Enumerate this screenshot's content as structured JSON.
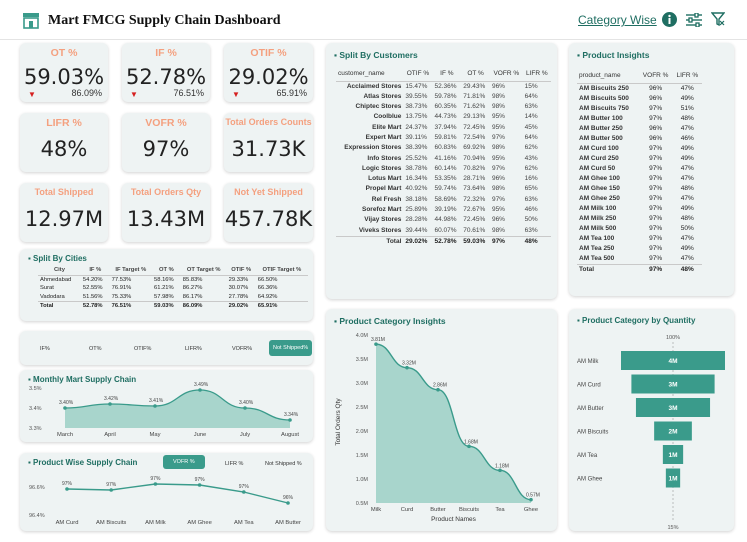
{
  "header": {
    "title": "Mart FMCG Supply Chain Dashboard",
    "link": "Category Wise",
    "icons": [
      "store-icon",
      "info-icon",
      "sliders-icon",
      "filter-clear-icon"
    ]
  },
  "colors": {
    "teal": "#3a9b8b",
    "orange": "#f4a07f",
    "card": "#eef3f3"
  },
  "kpis": {
    "ot": {
      "label": "OT %",
      "value": "59.03%",
      "target": "86.09%"
    },
    "if": {
      "label": "IF %",
      "value": "52.78%",
      "target": "76.51%"
    },
    "otif": {
      "label": "OTIF %",
      "value": "29.02%",
      "target": "65.91%"
    },
    "lifr": {
      "label": "LIFR %",
      "value": "48%"
    },
    "vofr": {
      "label": "VOFR %",
      "value": "97%"
    },
    "orders": {
      "label": "Total Orders Counts",
      "value": "31.73K"
    },
    "shipped": {
      "label": "Total Shipped",
      "value": "12.97M"
    },
    "qty": {
      "label": "Total Orders Qty",
      "value": "13.43M"
    },
    "notship": {
      "label": "Not Yet Shipped",
      "value": "457.78K"
    }
  },
  "cities": {
    "title": "Split By Cities",
    "headers": [
      "City",
      "IF %",
      "IF Target %",
      "OT %",
      "OT Target %",
      "OTIF %",
      "OTIF Target %"
    ],
    "rows": [
      [
        "Ahmedabad",
        "54.20%",
        "77.53%",
        "58.16%",
        "85.83%",
        "29.33%",
        "66.50%"
      ],
      [
        "Surat",
        "52.55%",
        "76.91%",
        "61.21%",
        "86.27%",
        "30.07%",
        "66.36%"
      ],
      [
        "Vadodara",
        "51.56%",
        "75.33%",
        "57.98%",
        "86.17%",
        "27.78%",
        "64.92%"
      ]
    ],
    "total": [
      "Total",
      "52.78%",
      "76.51%",
      "59.03%",
      "86.09%",
      "29.02%",
      "65.91%"
    ]
  },
  "toggles": {
    "items": [
      "IF%",
      "OT%",
      "OTIF%",
      "LIFR%",
      "VOFR%"
    ],
    "active": "Not Shipped%"
  },
  "customers": {
    "title": "Split By Customers",
    "headers": [
      "customer_name",
      "OTIF %",
      "IF %",
      "OT %",
      "VOFR %",
      "LIFR %"
    ],
    "rows": [
      [
        "Acclaimed Stores",
        "15.47%",
        "52.36%",
        "29.43%",
        "96%",
        "15%"
      ],
      [
        "Atlas Stores",
        "39.55%",
        "59.78%",
        "71.81%",
        "98%",
        "64%"
      ],
      [
        "Chiptec Stores",
        "38.73%",
        "60.35%",
        "71.62%",
        "98%",
        "63%"
      ],
      [
        "Coolblue",
        "13.75%",
        "44.73%",
        "29.13%",
        "95%",
        "14%"
      ],
      [
        "Elite Mart",
        "24.37%",
        "37.94%",
        "72.45%",
        "95%",
        "45%"
      ],
      [
        "Expert Mart",
        "39.11%",
        "59.81%",
        "72.54%",
        "97%",
        "64%"
      ],
      [
        "Expression Stores",
        "38.39%",
        "60.83%",
        "69.92%",
        "98%",
        "62%"
      ],
      [
        "Info Stores",
        "25.52%",
        "41.16%",
        "70.94%",
        "95%",
        "43%"
      ],
      [
        "Logic Stores",
        "38.78%",
        "60.14%",
        "70.82%",
        "97%",
        "62%"
      ],
      [
        "Lotus Mart",
        "16.34%",
        "53.35%",
        "28.71%",
        "96%",
        "16%"
      ],
      [
        "Propel Mart",
        "40.92%",
        "59.74%",
        "73.64%",
        "98%",
        "65%"
      ],
      [
        "Rel Fresh",
        "38.18%",
        "58.69%",
        "72.32%",
        "97%",
        "63%"
      ],
      [
        "Sorefoz Mart",
        "25.89%",
        "39.19%",
        "72.67%",
        "95%",
        "46%"
      ],
      [
        "Vijay Stores",
        "28.28%",
        "44.98%",
        "72.45%",
        "96%",
        "50%"
      ],
      [
        "Viveks Stores",
        "39.44%",
        "60.07%",
        "70.61%",
        "98%",
        "63%"
      ]
    ],
    "total": [
      "Total",
      "29.02%",
      "52.78%",
      "59.03%",
      "97%",
      "48%"
    ]
  },
  "products": {
    "title": "Product Insights",
    "headers": [
      "product_name",
      "VOFR %",
      "LIFR %"
    ],
    "rows": [
      [
        "AM Biscuits 250",
        "96%",
        "47%"
      ],
      [
        "AM Biscuits 500",
        "96%",
        "49%"
      ],
      [
        "AM Biscuits 750",
        "97%",
        "51%"
      ],
      [
        "AM Butter 100",
        "97%",
        "48%"
      ],
      [
        "AM Butter 250",
        "96%",
        "47%"
      ],
      [
        "AM Butter 500",
        "96%",
        "46%"
      ],
      [
        "AM Curd 100",
        "97%",
        "49%"
      ],
      [
        "AM Curd 250",
        "97%",
        "49%"
      ],
      [
        "AM Curd 50",
        "97%",
        "47%"
      ],
      [
        "AM Ghee 100",
        "97%",
        "47%"
      ],
      [
        "AM Ghee 150",
        "97%",
        "48%"
      ],
      [
        "AM Ghee 250",
        "97%",
        "47%"
      ],
      [
        "AM Milk 100",
        "97%",
        "49%"
      ],
      [
        "AM Milk 250",
        "97%",
        "48%"
      ],
      [
        "AM Milk 500",
        "97%",
        "50%"
      ],
      [
        "AM Tea 100",
        "97%",
        "47%"
      ],
      [
        "AM Tea 250",
        "97%",
        "49%"
      ],
      [
        "AM Tea 500",
        "97%",
        "47%"
      ]
    ],
    "total": [
      "Total",
      "97%",
      "48%"
    ]
  },
  "chart_data": [
    {
      "type": "area",
      "title": "Monthly Mart Supply Chain",
      "x": [
        "March",
        "April",
        "May",
        "June",
        "July",
        "August"
      ],
      "values": [
        3.4,
        3.42,
        3.41,
        3.49,
        3.4,
        3.34
      ],
      "ytick_labels": [
        "3.5%",
        "3.4%",
        "3.3%"
      ],
      "data_labels": [
        "3.40%",
        "3.42%",
        "3.41%",
        "3.49%",
        "3.40%",
        "3.34%"
      ],
      "ylim": [
        3.3,
        3.5
      ]
    },
    {
      "type": "line",
      "title": "Product Wise Supply Chain",
      "toggles": {
        "active": "VOFR %",
        "items": [
          "LIFR %",
          "Not Shipped %"
        ]
      },
      "x": [
        "AM Curd",
        "AM Biscuits",
        "AM Milk",
        "AM Ghee",
        "AM Tea",
        "AM Butter"
      ],
      "values": [
        97,
        97,
        97,
        97,
        97,
        96
      ],
      "data_labels": [
        "97%",
        "97%",
        "97%",
        "97%",
        "97%",
        "96%"
      ],
      "ytick_labels": [
        "96.6%",
        "96.4%"
      ]
    },
    {
      "type": "area",
      "title": "Product Category Insights",
      "x": [
        "Milk",
        "Curd",
        "Butter",
        "Biscuits",
        "Tea",
        "Ghee"
      ],
      "values": [
        3.81,
        3.32,
        2.86,
        1.68,
        1.18,
        0.57
      ],
      "data_labels": [
        "3.81M",
        "3.32M",
        "2.86M",
        "1.68M",
        "1.18M",
        "0.57M"
      ],
      "ylabel": "Total Orders Qty",
      "xlabel": "Product Names",
      "ytick_labels": [
        "4.0M",
        "3.5M",
        "3.0M",
        "2.5M",
        "2.0M",
        "1.5M",
        "1.0M",
        "0.5M"
      ],
      "ylim": [
        0.5,
        4.0
      ]
    },
    {
      "type": "bar",
      "title": "Product Category by Quantity",
      "categories": [
        "AM Milk",
        "AM Curd",
        "AM Butter",
        "AM Biscuits",
        "AM Tea",
        "AM Ghee"
      ],
      "values": [
        4,
        3,
        3,
        2,
        1,
        1
      ],
      "data_labels": [
        "4M",
        "3M",
        "3M",
        "2M",
        "1M",
        "1M"
      ],
      "percent_labels": [
        "100%",
        "15%"
      ]
    }
  ]
}
